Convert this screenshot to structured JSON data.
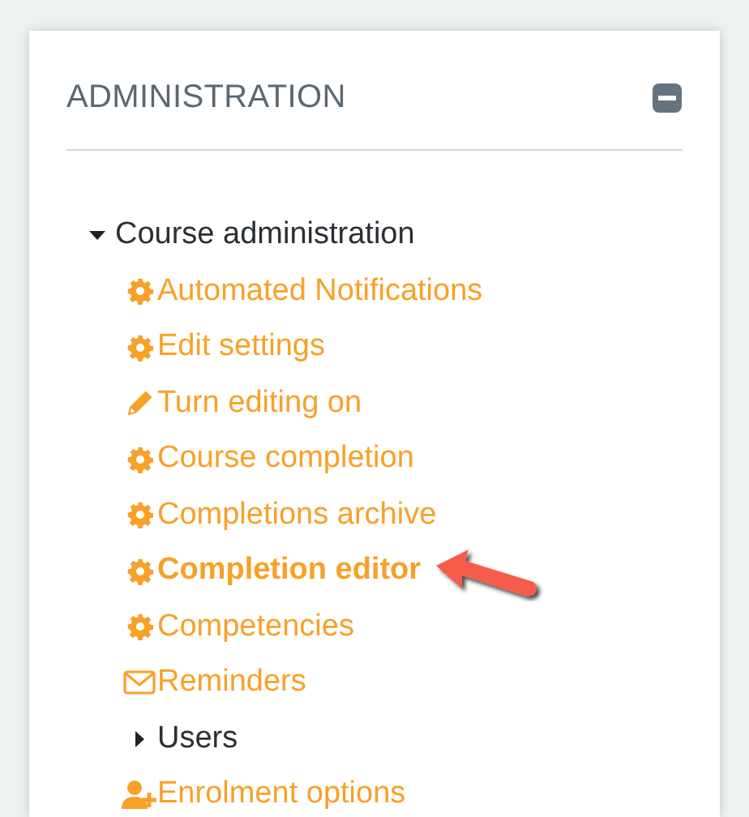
{
  "block": {
    "title": "ADMINISTRATION",
    "collapsed": false
  },
  "tree": [
    {
      "label": "Course administration",
      "kind": "node",
      "expanded": true,
      "children": [
        {
          "label": "Automated Notifications",
          "kind": "gear",
          "selected": false
        },
        {
          "label": "Edit settings",
          "kind": "gear",
          "selected": false
        },
        {
          "label": "Turn editing on",
          "kind": "pencil",
          "selected": false
        },
        {
          "label": "Course completion",
          "kind": "gear",
          "selected": false
        },
        {
          "label": "Completions archive",
          "kind": "gear",
          "selected": false
        },
        {
          "label": "Completion editor",
          "kind": "gear",
          "selected": true,
          "pointer": true
        },
        {
          "label": "Competencies",
          "kind": "gear",
          "selected": false
        },
        {
          "label": "Reminders",
          "kind": "mail",
          "selected": false
        },
        {
          "label": "Users",
          "kind": "node",
          "expanded": false,
          "selected": false
        },
        {
          "label": "Enrolment options",
          "kind": "user-add",
          "selected": false
        }
      ]
    }
  ]
}
